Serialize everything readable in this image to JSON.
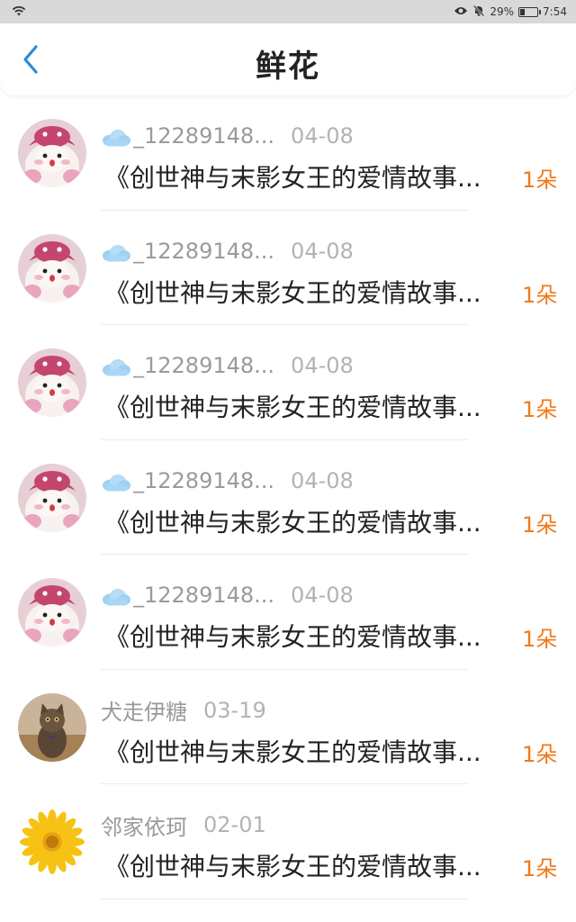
{
  "status_bar": {
    "battery": "29%",
    "battery_level": 0.29,
    "time": "7:54"
  },
  "header": {
    "title": "鲜花"
  },
  "colors": {
    "accent": "#2a8bd8",
    "count": "#f07a1a",
    "muted": "#9a9a9a"
  },
  "items": [
    {
      "avatar": "pink-mascot",
      "cloud": true,
      "name": "_12289148...",
      "date": "04-08",
      "message": "《创世神与末影女王的爱情故事...",
      "count": "1朵"
    },
    {
      "avatar": "pink-mascot",
      "cloud": true,
      "name": "_12289148...",
      "date": "04-08",
      "message": "《创世神与末影女王的爱情故事...",
      "count": "1朵"
    },
    {
      "avatar": "pink-mascot",
      "cloud": true,
      "name": "_12289148...",
      "date": "04-08",
      "message": "《创世神与末影女王的爱情故事...",
      "count": "1朵"
    },
    {
      "avatar": "pink-mascot",
      "cloud": true,
      "name": "_12289148...",
      "date": "04-08",
      "message": "《创世神与末影女王的爱情故事...",
      "count": "1朵"
    },
    {
      "avatar": "pink-mascot",
      "cloud": true,
      "name": "_12289148...",
      "date": "04-08",
      "message": "《创世神与末影女王的爱情故事...",
      "count": "1朵"
    },
    {
      "avatar": "kitten",
      "cloud": false,
      "name": "犬走伊糖",
      "date": "03-19",
      "message": "《创世神与末影女王的爱情故事...",
      "count": "1朵"
    },
    {
      "avatar": "sunflower",
      "cloud": false,
      "name": "邻家依珂",
      "date": "02-01",
      "message": "《创世神与末影女王的爱情故事...",
      "count": "1朵"
    }
  ]
}
